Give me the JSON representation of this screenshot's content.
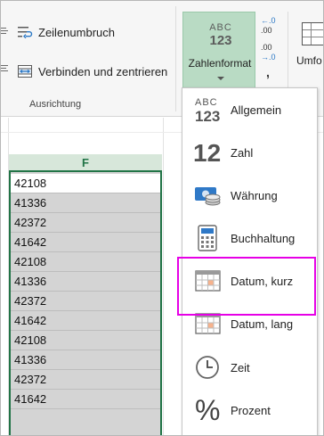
{
  "ribbon": {
    "wrap_text_label": "Zeilenumbruch",
    "merge_center_label": "Verbinden und zentrieren",
    "group_label": "Ausrichtung",
    "number_format_label": "Zahlenformat",
    "number_format_icon_abc": "ABC",
    "number_format_icon_123": "123",
    "increase_decimal_top": "←.0",
    "increase_decimal_bottom": ".00",
    "decrease_decimal_top": ".00",
    "decrease_decimal_bottom": "→.0",
    "comma_style": ",",
    "format_as_table_label": "Umfo"
  },
  "sheet": {
    "column_header": "F",
    "cells": [
      "42108",
      "41336",
      "42372",
      "41642",
      "42108",
      "41336",
      "42372",
      "41642",
      "42108",
      "41336",
      "42372",
      "41642"
    ]
  },
  "menu": {
    "items": [
      {
        "label": "Allgemein",
        "icon": "general-format-icon"
      },
      {
        "label": "Zahl",
        "icon": "number-format-icon"
      },
      {
        "label": "Währung",
        "icon": "currency-icon"
      },
      {
        "label": "Buchhaltung",
        "icon": "accounting-calculator-icon"
      },
      {
        "label": "Datum, kurz",
        "icon": "calendar-icon"
      },
      {
        "label": "Datum, lang",
        "icon": "calendar-icon"
      },
      {
        "label": "Zeit",
        "icon": "clock-icon"
      },
      {
        "label": "Prozent",
        "icon": "percent-icon"
      }
    ],
    "icon_text_abc": "ABC",
    "icon_text_123": "123",
    "icon_text_12": "12",
    "icon_text_pct": "%"
  },
  "colors": {
    "excel_green": "#217346",
    "selection_gray": "#d4d4d4",
    "highlight_magenta": "#e600e6",
    "button_active": "#b9dbc4"
  }
}
